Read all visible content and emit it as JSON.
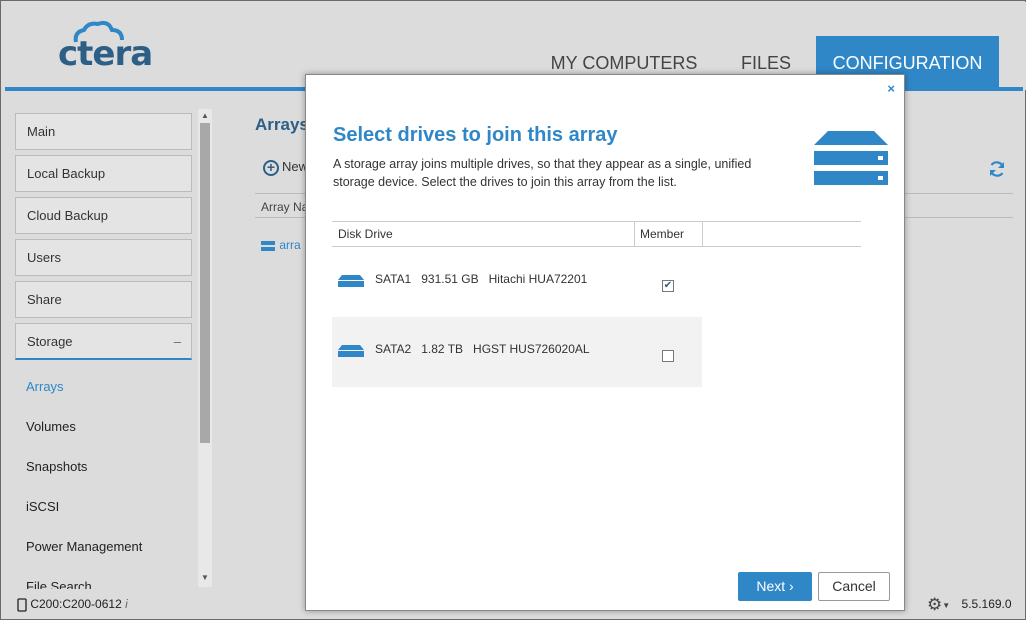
{
  "header": {
    "logo_text": "ctera",
    "tabs": [
      {
        "label": "MY COMPUTERS"
      },
      {
        "label": "FILES"
      },
      {
        "label": "CONFIGURATION"
      }
    ]
  },
  "sidebar": {
    "items": [
      {
        "label": "Main"
      },
      {
        "label": "Local Backup"
      },
      {
        "label": "Cloud Backup"
      },
      {
        "label": "Users"
      },
      {
        "label": "Share"
      },
      {
        "label": "Storage"
      }
    ],
    "collapse_symbol": "–",
    "subitems": [
      {
        "label": "Arrays"
      },
      {
        "label": "Volumes"
      },
      {
        "label": "Snapshots"
      },
      {
        "label": "iSCSI"
      },
      {
        "label": "Power Management"
      },
      {
        "label": "File Search"
      }
    ]
  },
  "main": {
    "title": "Arrays",
    "new_label": "New",
    "column": "Array Na",
    "row": "arra"
  },
  "footer": {
    "device": "C200:C200-0612",
    "version": "5.5.169.0"
  },
  "modal": {
    "close": "×",
    "title": "Select drives to join this array",
    "description": "A storage array joins multiple drives, so that they appear as a single, unified storage device. Select the drives to join this array from the list.",
    "columns": {
      "drive": "Disk Drive",
      "member": "Member"
    },
    "drives": [
      {
        "text": "SATA1   931.51 GB   Hitachi HUA72201",
        "member": true
      },
      {
        "text": "SATA2   1.82 TB   HGST HUS726020AL",
        "member": false
      }
    ],
    "next_label": "Next ›",
    "cancel_label": "Cancel"
  },
  "colors": {
    "accent": "#2f87c8",
    "brand": "#2d5f86"
  }
}
